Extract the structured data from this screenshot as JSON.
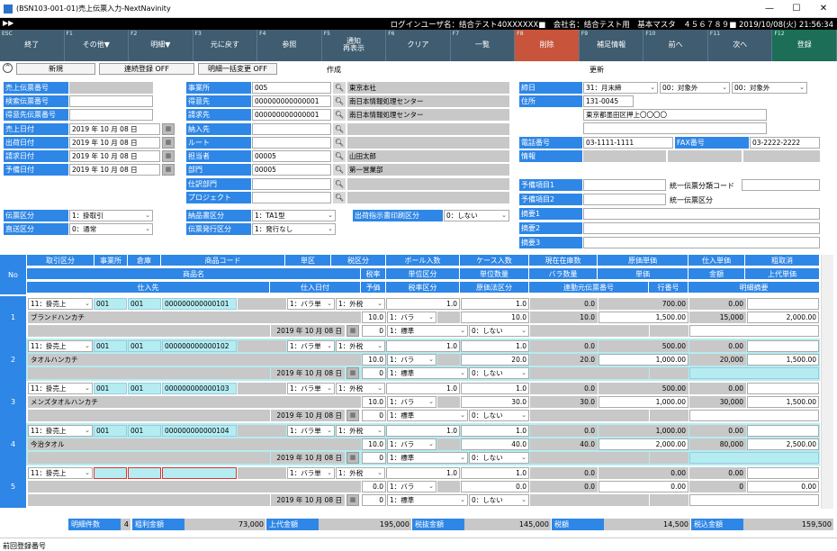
{
  "window": {
    "title": "(BSN103-001-01)売上伝票入力-NextNavinity",
    "min": "—",
    "max": "☐",
    "close": "✕"
  },
  "infobar": {
    "left": "▶▶",
    "right": "ログインユーザ名：结合テスト40XXXXXX■　会社名：结合テスト用　基本マスタ　４５６７８９■ 2019/10/08(火) 21:56:34"
  },
  "fkeys": [
    {
      "fn": "ESC",
      "label": "終了",
      "bg": "#3f5c70"
    },
    {
      "fn": "F1",
      "label": "その他▼",
      "bg": "#3f5c70"
    },
    {
      "fn": "F2",
      "label": "明細▼",
      "bg": "#3f5c70"
    },
    {
      "fn": "F3",
      "label": "元に戻す",
      "bg": "#3f5c70"
    },
    {
      "fn": "F4",
      "label": "参照",
      "bg": "#3f5c70"
    },
    {
      "fn": "F5",
      "label": "通知\n再表示",
      "bg": "#3f5c70"
    },
    {
      "fn": "F6",
      "label": "クリア",
      "bg": "#3f5c70"
    },
    {
      "fn": "F7",
      "label": "一覧",
      "bg": "#3f5c70"
    },
    {
      "fn": "F8",
      "label": "削除",
      "bg": "#c8543c"
    },
    {
      "fn": "F9",
      "label": "補足情報",
      "bg": "#3f5c70"
    },
    {
      "fn": "F10",
      "label": "前へ",
      "bg": "#3f5c70"
    },
    {
      "fn": "F11",
      "label": "次へ",
      "bg": "#3f5c70"
    },
    {
      "fn": "F12",
      "label": "登録",
      "bg": "#1c6e56"
    }
  ],
  "toolbar": {
    "collapse": "^",
    "new_btn": "新規",
    "continuous_btn": "連続登録 OFF",
    "bulk_btn": "明細一括変更 OFF",
    "mode_create": "作成",
    "mode_update": "更新"
  },
  "left": {
    "sales_slip_no": "売上伝票番号",
    "search_slip_no": "検索伝票番号",
    "customer_slip_no": "得意先伝票番号",
    "sales_date": "売上日付",
    "sales_date_v": "2019 年 10 月 08 日",
    "ship_date": "出荷日付",
    "ship_date_v": "2019 年 10 月 08 日",
    "bill_date": "請求日付",
    "bill_date_v": "2019 年 10 月 08 日",
    "plan_date": "予備日付",
    "plan_date_v": "2019 年 10 月 08 日",
    "slip_type": "伝票区分",
    "slip_type_v": "1：掛取引",
    "direct_type": "直送区分",
    "direct_type_v": "0：通常"
  },
  "mid": {
    "office": "事業所",
    "office_code": "005",
    "office_name": "東京本社",
    "customer": "得意先",
    "customer_code": "000000000000001",
    "customer_name": "南日本情報処理センター",
    "billing": "請求先",
    "billing_code": "000000000000001",
    "billing_name": "南日本情報処理センター",
    "delivery": "納入先",
    "route": "ルート",
    "staff": "担当者",
    "staff_code": "00005",
    "staff_name": "山田太郎",
    "dept": "部門",
    "dept_code": "00005",
    "dept_name": "第一営業部",
    "purchase_dept": "仕訳部門",
    "project": "プロジェクト",
    "delivery_note": "納品書区分",
    "delivery_note_v": "1：TA1型",
    "slip_issue": "伝票発行区分",
    "slip_issue_v": "1：発行なし",
    "ship_print": "出荷指示書印刷区分",
    "ship_print_v": "0：しない"
  },
  "right": {
    "closing": "締日",
    "closing_v": "31：月末締",
    "closing_v2": "00：対象外",
    "closing_v3": "00：対象外",
    "address": "住所",
    "zip": "131-0045",
    "addr_line": "東京都墨田区押上〇〇〇〇",
    "phone": "電話番号",
    "phone_v": "03-1111-1111",
    "fax": "FAX番号",
    "fax_v": "03-2222-2222",
    "info": "情報",
    "spare1": "予備項目1",
    "unified_code": "統一伝票分類コード",
    "spare2": "予備項目2",
    "unified_type": "統一伝票区分",
    "memo1": "摘要1",
    "memo2": "摘要2",
    "memo3": "摘要3"
  },
  "grid": {
    "no": "No",
    "h1": [
      "取引区分",
      "事業所",
      "倉庫",
      "商品コード",
      "単区",
      "税区分",
      "ボール入数",
      "ケース入数",
      "現在在庫数",
      "原価単価",
      "仕入単価",
      "粗取消"
    ],
    "h2": [
      "商品名",
      "税率",
      "単位区分",
      "単位数量",
      "バラ数量",
      "単価",
      "金額",
      "上代単価"
    ],
    "h3": [
      "仕入先",
      "仕入日付",
      "予価",
      "税率区分",
      "原価法区分",
      "連動元伝票番号",
      "行番号",
      "明細摘要"
    ],
    "rows": [
      {
        "no": "1",
        "type": "11：掛売上",
        "office": "001",
        "wh": "001",
        "code": "000000000000101",
        "unit": "1：バラ単",
        "tax": "1：外税",
        "ball": "1.0",
        "case": "1.0",
        "stock": "0.0",
        "cost": "700.00",
        "pur": "0.00",
        "name": "ブランドハンカチ",
        "rate": "10.0",
        "ukind": "1：バラ",
        "uqty": "10.0",
        "bqty": "10.0",
        "price": "1,500.00",
        "amount": "15,000",
        "retail": "2,000.00",
        "pdate": "2019 年 10 月 08 日",
        "prc": "0",
        "taxk": "1：標準",
        "costm": "0：しない",
        "cyan": false
      },
      {
        "no": "2",
        "type": "11：掛売上",
        "office": "001",
        "wh": "001",
        "code": "000000000000102",
        "unit": "1：バラ単",
        "tax": "1：外税",
        "ball": "1.0",
        "case": "1.0",
        "stock": "0.0",
        "cost": "500.00",
        "pur": "0.00",
        "name": "タオルハンカチ",
        "rate": "10.0",
        "ukind": "1：バラ",
        "uqty": "20.0",
        "bqty": "20.0",
        "price": "1,000.00",
        "amount": "20,000",
        "retail": "1,500.00",
        "pdate": "2019 年 10 月 08 日",
        "prc": "0",
        "taxk": "1：標準",
        "costm": "0：しない",
        "cyan": true
      },
      {
        "no": "3",
        "type": "11：掛売上",
        "office": "001",
        "wh": "001",
        "code": "000000000000103",
        "unit": "1：バラ単",
        "tax": "1：外税",
        "ball": "1.0",
        "case": "1.0",
        "stock": "0.0",
        "cost": "500.00",
        "pur": "0.00",
        "name": "メンズタオルハンカチ",
        "rate": "10.0",
        "ukind": "1：バラ",
        "uqty": "30.0",
        "bqty": "30.0",
        "price": "1,000.00",
        "amount": "30,000",
        "retail": "1,500.00",
        "pdate": "2019 年 10 月 08 日",
        "prc": "0",
        "taxk": "1：標準",
        "costm": "0：しない",
        "cyan": false
      },
      {
        "no": "4",
        "type": "11：掛売上",
        "office": "001",
        "wh": "001",
        "code": "000000000000104",
        "unit": "1：バラ単",
        "tax": "1：外税",
        "ball": "1.0",
        "case": "1.0",
        "stock": "0.0",
        "cost": "1,000.00",
        "pur": "0.00",
        "name": "今治タオル",
        "rate": "10.0",
        "ukind": "1：バラ",
        "uqty": "40.0",
        "bqty": "40.0",
        "price": "2,000.00",
        "amount": "80,000",
        "retail": "2,500.00",
        "pdate": "2019 年 10 月 08 日",
        "prc": "0",
        "taxk": "1：標準",
        "costm": "0：しない",
        "cyan": true
      },
      {
        "no": "5",
        "type": "11：掛売上",
        "office": "",
        "wh": "",
        "code": "",
        "unit": "1：バラ単",
        "tax": "1：外税",
        "ball": "1.0",
        "case": "1.0",
        "stock": "0.0",
        "cost": "0.00",
        "pur": "0.00",
        "name": "",
        "rate": "0.0",
        "ukind": "1：バラ",
        "uqty": "0.0",
        "bqty": "0.0",
        "price": "0.00",
        "amount": "0",
        "retail": "0.00",
        "pdate": "2019 年 10 月 08 日",
        "prc": "0",
        "taxk": "1：標準",
        "costm": "0：しない",
        "cyan": false,
        "empty": true
      }
    ]
  },
  "footer": {
    "count_l": "明細件数",
    "count_v": "4",
    "profit_l": "粗利金額",
    "profit_v": "73,000",
    "retail_l": "上代金額",
    "retail_v": "195,000",
    "excl_l": "税抜金額",
    "excl_v": "145,000",
    "tax_l": "税額",
    "tax_v": "14,500",
    "incl_l": "税込金額",
    "incl_v": "159,500"
  },
  "status": {
    "text": "前回登録番号"
  }
}
